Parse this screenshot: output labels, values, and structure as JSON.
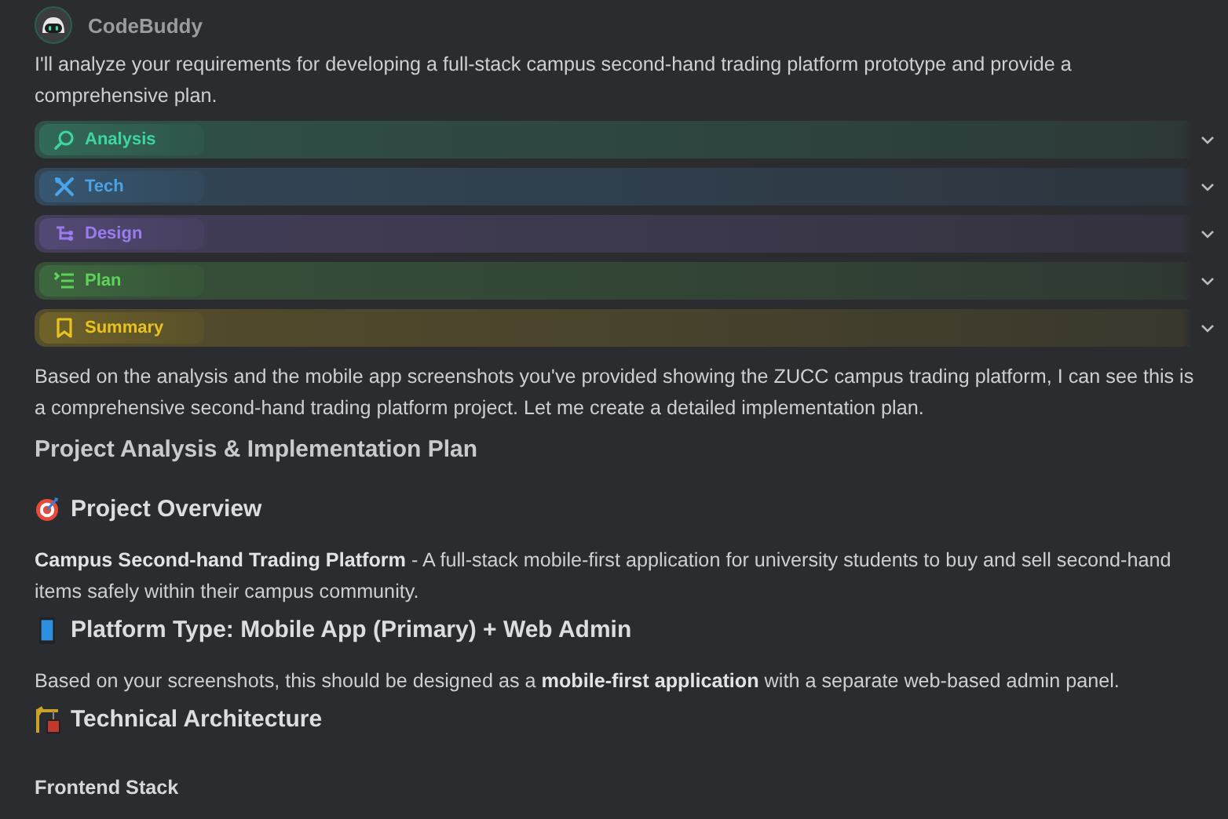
{
  "assistant": {
    "name": "CodeBuddy"
  },
  "intro": "I'll analyze your requirements for developing a full-stack campus second-hand trading platform prototype and provide a comprehensive plan.",
  "steps": [
    {
      "kind": "analysis",
      "label": "Analysis",
      "color": "#3ed6a0",
      "expanded": false
    },
    {
      "kind": "tech",
      "label": "Tech",
      "color": "#4aa3e8",
      "expanded": false
    },
    {
      "kind": "design",
      "label": "Design",
      "color": "#9b7cf0",
      "expanded": false
    },
    {
      "kind": "plan",
      "label": "Plan",
      "color": "#5ed35a",
      "expanded": false
    },
    {
      "kind": "summary",
      "label": "Summary",
      "color": "#e8c21e",
      "expanded": false
    }
  ],
  "blocks": [
    {
      "kind": "paragraph",
      "text": "Based on the analysis and the mobile app screenshots you've provided showing the ZUCC campus trading platform, I can see this is a comprehensive second-hand trading platform project. Let me create a detailed implementation plan."
    },
    {
      "kind": "title",
      "text": "Project Analysis & Implementation Plan"
    },
    {
      "kind": "section",
      "text": "Project Overview"
    },
    {
      "kind": "paragraph",
      "text": "**Campus Second-hand Trading Platform** - A full-stack mobile-first application for university students to buy and sell second-hand items safely within their campus community."
    },
    {
      "kind": "section",
      "text": "Platform Type: Mobile App (Primary) + Web Admin"
    },
    {
      "kind": "paragraph",
      "text": "Based on your screenshots, this should be designed as a **mobile-first application** with a separate web-based admin panel."
    },
    {
      "kind": "section",
      "text": "Technical Architecture"
    },
    {
      "kind": "subheading",
      "text": "Frontend Stack"
    }
  ]
}
